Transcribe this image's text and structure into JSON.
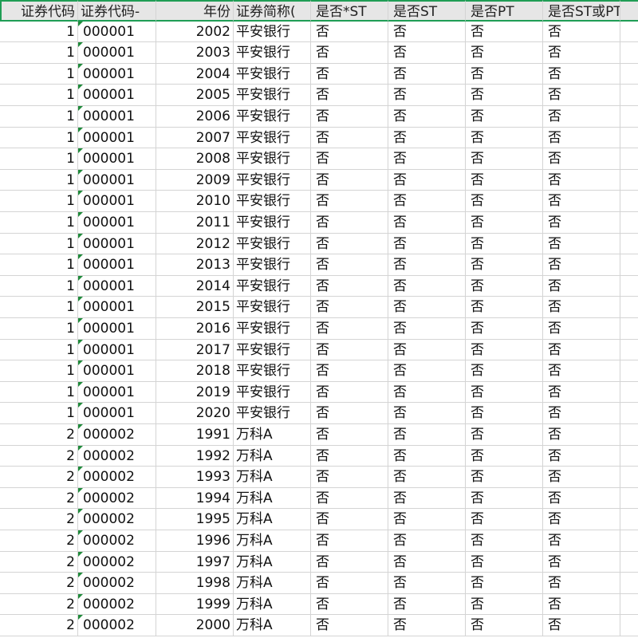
{
  "sheet": {
    "headers": [
      "证券代码",
      "证券代码-",
      "年份",
      "证券简称(",
      "是否*ST",
      "是否ST",
      "是否PT",
      "是否ST或PT",
      ""
    ],
    "rows": [
      [
        "1",
        "000001",
        "2002",
        "平安银行",
        "否",
        "否",
        "否",
        "否"
      ],
      [
        "1",
        "000001",
        "2003",
        "平安银行",
        "否",
        "否",
        "否",
        "否"
      ],
      [
        "1",
        "000001",
        "2004",
        "平安银行",
        "否",
        "否",
        "否",
        "否"
      ],
      [
        "1",
        "000001",
        "2005",
        "平安银行",
        "否",
        "否",
        "否",
        "否"
      ],
      [
        "1",
        "000001",
        "2006",
        "平安银行",
        "否",
        "否",
        "否",
        "否"
      ],
      [
        "1",
        "000001",
        "2007",
        "平安银行",
        "否",
        "否",
        "否",
        "否"
      ],
      [
        "1",
        "000001",
        "2008",
        "平安银行",
        "否",
        "否",
        "否",
        "否"
      ],
      [
        "1",
        "000001",
        "2009",
        "平安银行",
        "否",
        "否",
        "否",
        "否"
      ],
      [
        "1",
        "000001",
        "2010",
        "平安银行",
        "否",
        "否",
        "否",
        "否"
      ],
      [
        "1",
        "000001",
        "2011",
        "平安银行",
        "否",
        "否",
        "否",
        "否"
      ],
      [
        "1",
        "000001",
        "2012",
        "平安银行",
        "否",
        "否",
        "否",
        "否"
      ],
      [
        "1",
        "000001",
        "2013",
        "平安银行",
        "否",
        "否",
        "否",
        "否"
      ],
      [
        "1",
        "000001",
        "2014",
        "平安银行",
        "否",
        "否",
        "否",
        "否"
      ],
      [
        "1",
        "000001",
        "2015",
        "平安银行",
        "否",
        "否",
        "否",
        "否"
      ],
      [
        "1",
        "000001",
        "2016",
        "平安银行",
        "否",
        "否",
        "否",
        "否"
      ],
      [
        "1",
        "000001",
        "2017",
        "平安银行",
        "否",
        "否",
        "否",
        "否"
      ],
      [
        "1",
        "000001",
        "2018",
        "平安银行",
        "否",
        "否",
        "否",
        "否"
      ],
      [
        "1",
        "000001",
        "2019",
        "平安银行",
        "否",
        "否",
        "否",
        "否"
      ],
      [
        "1",
        "000001",
        "2020",
        "平安银行",
        "否",
        "否",
        "否",
        "否"
      ],
      [
        "2",
        "000002",
        "1991",
        "万科A",
        "否",
        "否",
        "否",
        "否"
      ],
      [
        "2",
        "000002",
        "1992",
        "万科A",
        "否",
        "否",
        "否",
        "否"
      ],
      [
        "2",
        "000002",
        "1993",
        "万科A",
        "否",
        "否",
        "否",
        "否"
      ],
      [
        "2",
        "000002",
        "1994",
        "万科A",
        "否",
        "否",
        "否",
        "否"
      ],
      [
        "2",
        "000002",
        "1995",
        "万科A",
        "否",
        "否",
        "否",
        "否"
      ],
      [
        "2",
        "000002",
        "1996",
        "万科A",
        "否",
        "否",
        "否",
        "否"
      ],
      [
        "2",
        "000002",
        "1997",
        "万科A",
        "否",
        "否",
        "否",
        "否"
      ],
      [
        "2",
        "000002",
        "1998",
        "万科A",
        "否",
        "否",
        "否",
        "否"
      ],
      [
        "2",
        "000002",
        "1999",
        "万科A",
        "否",
        "否",
        "否",
        "否"
      ],
      [
        "2",
        "000002",
        "2000",
        "万科A",
        "否",
        "否",
        "否",
        "否"
      ]
    ]
  },
  "colors": {
    "header_bg": "#e6e6e6",
    "selection_border": "#1f9d55",
    "gridline": "#d4d4d4",
    "text_marker": "#1f8a3a"
  },
  "icons": {
    "number_as_text_marker": "green-triangle-icon"
  }
}
